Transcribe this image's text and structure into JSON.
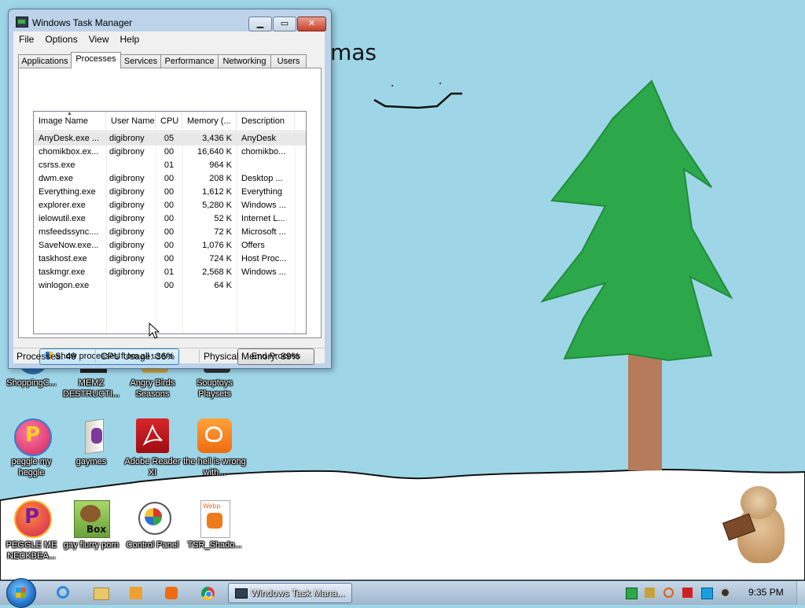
{
  "wallpaper": {
    "text": "mas"
  },
  "desktop_icons": [
    {
      "label": "ShoppingC..."
    },
    {
      "label": "MEMZ DESTRUCTI..."
    },
    {
      "label": "Angry Birds Seasons"
    },
    {
      "label": "Souptoys Playsets"
    },
    {
      "label": "peggle my heggle"
    },
    {
      "label": "gaymes"
    },
    {
      "label": "Adobe Reader XI"
    },
    {
      "label": "the hell is wrong with..."
    },
    {
      "label": "PEGGLE ME NECKBEA..."
    },
    {
      "label": "gay flurry porn"
    },
    {
      "label": "Control Panel"
    },
    {
      "label": "TSR_Shado..."
    }
  ],
  "taskmgr": {
    "title": "Windows Task Manager",
    "menu": [
      "File",
      "Options",
      "View",
      "Help"
    ],
    "tabs": [
      "Applications",
      "Processes",
      "Services",
      "Performance",
      "Networking",
      "Users"
    ],
    "active_tab": "Processes",
    "columns": [
      "Image Name",
      "User Name",
      "CPU",
      "Memory (...",
      "Description"
    ],
    "processes": [
      {
        "image": "AnyDesk.exe ...",
        "user": "digibrony",
        "cpu": "05",
        "mem": "3,436 K",
        "desc": "AnyDesk"
      },
      {
        "image": "chomikbox.ex...",
        "user": "digibrony",
        "cpu": "00",
        "mem": "16,640 K",
        "desc": "chomikbo..."
      },
      {
        "image": "csrss.exe",
        "user": "",
        "cpu": "01",
        "mem": "964 K",
        "desc": ""
      },
      {
        "image": "dwm.exe",
        "user": "digibrony",
        "cpu": "00",
        "mem": "208 K",
        "desc": "Desktop ..."
      },
      {
        "image": "Everything.exe",
        "user": "digibrony",
        "cpu": "00",
        "mem": "1,612 K",
        "desc": "Everything"
      },
      {
        "image": "explorer.exe",
        "user": "digibrony",
        "cpu": "00",
        "mem": "5,280 K",
        "desc": "Windows ..."
      },
      {
        "image": "ielowutil.exe",
        "user": "digibrony",
        "cpu": "00",
        "mem": "52 K",
        "desc": "Internet L..."
      },
      {
        "image": "msfeedssync....",
        "user": "digibrony",
        "cpu": "00",
        "mem": "72 K",
        "desc": "Microsoft ..."
      },
      {
        "image": "SaveNow.exe...",
        "user": "digibrony",
        "cpu": "00",
        "mem": "1,076 K",
        "desc": "Offers"
      },
      {
        "image": "taskhost.exe",
        "user": "digibrony",
        "cpu": "00",
        "mem": "724 K",
        "desc": "Host Proc..."
      },
      {
        "image": "taskmgr.exe",
        "user": "digibrony",
        "cpu": "01",
        "mem": "2,568 K",
        "desc": "Windows ..."
      },
      {
        "image": "winlogon.exe",
        "user": "",
        "cpu": "00",
        "mem": "64 K",
        "desc": ""
      }
    ],
    "show_all_label": "Show processes from all users",
    "end_process_label": "End Process",
    "status": {
      "processes": "Processes: 49",
      "cpu": "CPU Usage: 36%",
      "memory": "Physical Memory: 89%"
    }
  },
  "taskbar": {
    "task_label": "Windows Task Mana...",
    "clock": "9:35 PM"
  }
}
